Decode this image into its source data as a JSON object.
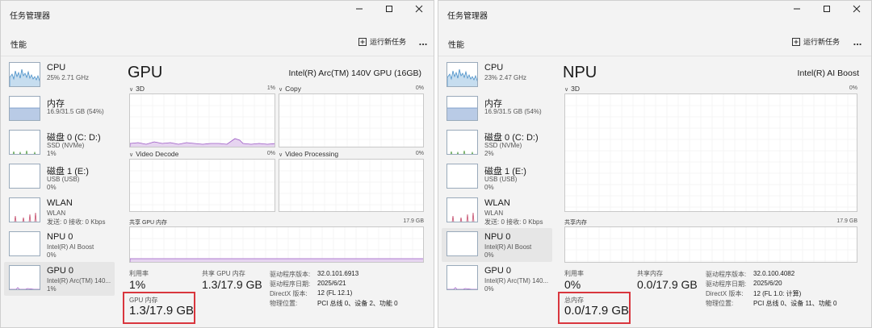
{
  "windows": [
    {
      "title": "任务管理器",
      "page_title": "性能",
      "run_new_task": "运行新任务",
      "more": "...",
      "main": {
        "title": "GPU",
        "device": "Intel(R) Arc(TM) 140V GPU (16GB)",
        "graphs": [
          {
            "label": "3D",
            "pct": "1%"
          },
          {
            "label": "Copy",
            "pct": "0%"
          },
          {
            "label": "Video Decode",
            "pct": "0%"
          },
          {
            "label": "Video Processing",
            "pct": "0%"
          }
        ],
        "shared_label": "共享 GPU 内存",
        "shared_max": "17.9 GB",
        "stats": {
          "util_label": "利用率",
          "util_value": "1%",
          "shared_label": "共享 GPU 内存",
          "shared_value": "1.3/17.9 GB",
          "mem_label": "GPU 内存",
          "mem_value": "1.3/17.9 GB",
          "details": [
            {
              "k": "驱动程序版本:",
              "v": "32.0.101.6913"
            },
            {
              "k": "驱动程序日期:",
              "v": "2025/6/21"
            },
            {
              "k": "DirectX 版本:",
              "v": "12 (FL 12.1)"
            },
            {
              "k": "物理位置:",
              "v": "PCI 总线 0、设备 2、功能 0"
            }
          ]
        }
      }
    },
    {
      "title": "任务管理器",
      "page_title": "性能",
      "run_new_task": "运行新任务",
      "more": "...",
      "main": {
        "title": "NPU",
        "device": "Intel(R) AI Boost",
        "graphs": [
          {
            "label": "3D",
            "pct": "0%"
          }
        ],
        "shared_label": "共享内存",
        "shared_max": "17.9 GB",
        "stats": {
          "util_label": "利用率",
          "util_value": "0%",
          "shared_label": "共享内存",
          "shared_value": "0.0/17.9 GB",
          "mem_label": "总内存",
          "mem_value": "0.0/17.9 GB",
          "details": [
            {
              "k": "驱动程序版本:",
              "v": "32.0.100.4082"
            },
            {
              "k": "驱动程序日期:",
              "v": "2025/6/20"
            },
            {
              "k": "DirectX 版本:",
              "v": "12 (FL 1.0: 计算)"
            },
            {
              "k": "物理位置:",
              "v": "PCI 总线 0、设备 11、功能 0"
            }
          ]
        }
      }
    }
  ],
  "sidebar": {
    "left": [
      {
        "name": "CPU",
        "sub": "25%  2.71 GHz",
        "sub2": ""
      },
      {
        "name": "内存",
        "sub": "16.9/31.5 GB (54%)",
        "sub2": ""
      },
      {
        "name": "磁盘 0 (C: D:)",
        "sub": "SSD (NVMe)",
        "sub2": "1%"
      },
      {
        "name": "磁盘 1 (E:)",
        "sub": "USB (USB)",
        "sub2": "0%"
      },
      {
        "name": "WLAN",
        "sub": "WLAN",
        "sub2": "发送: 0  接收: 0 Kbps"
      },
      {
        "name": "NPU 0",
        "sub": "Intel(R) AI Boost",
        "sub2": "0%"
      },
      {
        "name": "GPU 0",
        "sub": "Intel(R) Arc(TM) 140...",
        "sub2": "1%"
      }
    ],
    "right": [
      {
        "name": "CPU",
        "sub": "23%  2.47 GHz",
        "sub2": ""
      },
      {
        "name": "内存",
        "sub": "16.9/31.5 GB (54%)",
        "sub2": ""
      },
      {
        "name": "磁盘 0 (C: D:)",
        "sub": "SSD (NVMe)",
        "sub2": "2%"
      },
      {
        "name": "磁盘 1 (E:)",
        "sub": "USB (USB)",
        "sub2": "0%"
      },
      {
        "name": "WLAN",
        "sub": "WLAN",
        "sub2": "发送: 0  接收: 0 Kbps"
      },
      {
        "name": "NPU 0",
        "sub": "Intel(R) AI Boost",
        "sub2": "0%"
      },
      {
        "name": "GPU 0",
        "sub": "Intel(R) Arc(TM) 140...",
        "sub2": "0%"
      }
    ],
    "left_selected": 6,
    "right_selected": 5
  },
  "colors": {
    "cpu": "#4a90c8",
    "mem": "#6a8fc0",
    "disk": "#5aa04a",
    "wlan": "#c44a6a",
    "gpu": "#9b59c4",
    "highlight": "#d9363e"
  },
  "icons": {
    "run_task": "run-task-icon",
    "more": "more-icon",
    "minimize": "minimize-icon",
    "maximize": "maximize-icon",
    "close": "close-icon"
  }
}
